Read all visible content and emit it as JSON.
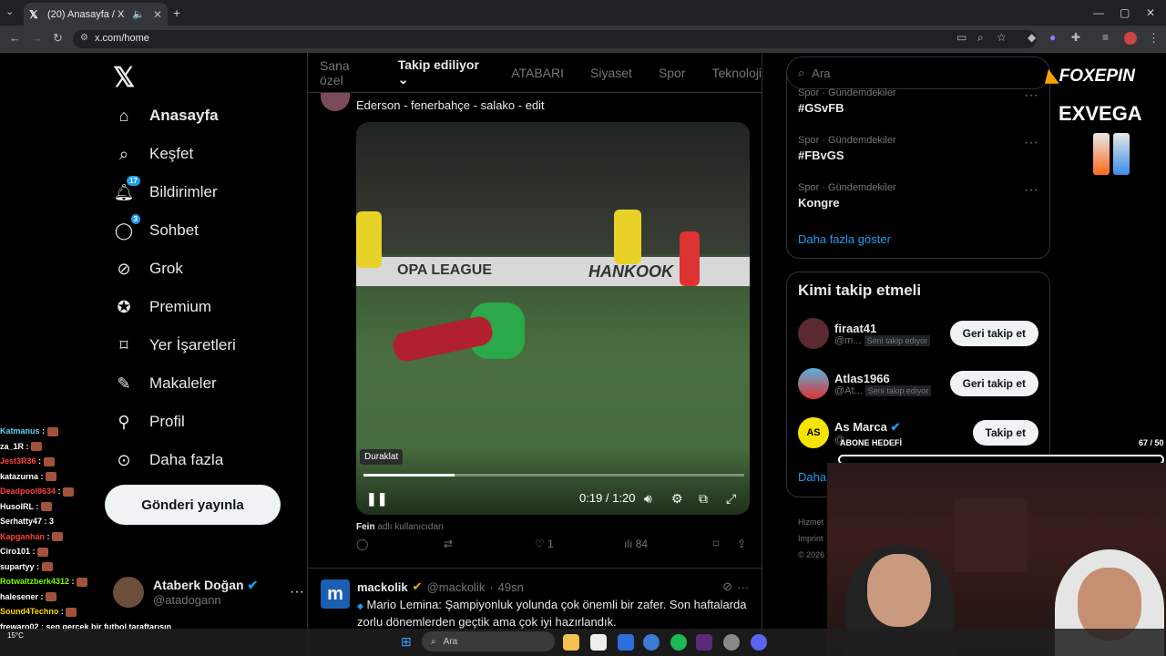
{
  "browser": {
    "tab_title": "(20) Anasayfa / X",
    "url": "x.com/home"
  },
  "sidebar": {
    "items": [
      {
        "label": "Anasayfa",
        "icon": "home-icon"
      },
      {
        "label": "Keşfet",
        "icon": "search-icon"
      },
      {
        "label": "Bildirimler",
        "icon": "bell-icon",
        "badge": "17"
      },
      {
        "label": "Sohbet",
        "icon": "chat-icon",
        "badge": "3"
      },
      {
        "label": "Grok",
        "icon": "grok-icon"
      },
      {
        "label": "Premium",
        "icon": "premium-icon"
      },
      {
        "label": "Yer İşaretleri",
        "icon": "bookmark-icon"
      },
      {
        "label": "Makaleler",
        "icon": "article-icon"
      },
      {
        "label": "Profil",
        "icon": "profile-icon"
      },
      {
        "label": "Daha fazla",
        "icon": "more-circle-icon"
      }
    ],
    "post_button": "Gönderi yayınla",
    "user": {
      "name": "Ataberk Doğan",
      "handle": "@atadogann"
    }
  },
  "feed": {
    "tabs": [
      "Sana özel",
      "Takip ediliyor",
      "ATABARI",
      "Siyaset",
      "Spor",
      "Teknoloji"
    ],
    "active_tab": "Takip ediliyor",
    "tweet1": {
      "text": "Ederson - fenerbahçe - salako - edit",
      "video": {
        "tooltip": "Duraklat",
        "time": "0:19 / 1:20",
        "progress": 0.24,
        "ad_text": "OPA LEAGUE",
        "ad_brand": "HANKOOK"
      },
      "source_user": "Fein",
      "source_suffix": "adlı kullanıcıdan",
      "likes": "1",
      "views": "84"
    },
    "tweet2": {
      "name": "mackolik",
      "handle": "@mackolik",
      "time": "49sn",
      "avatar_letter": "m",
      "text": "Mario Lemina: Şampiyonluk yolunda çok önemli bir zafer. Son haftalarda zorlu dönemlerden geçtik ama çok iyi hazırlandık."
    }
  },
  "right": {
    "search_placeholder": "Ara",
    "trends": [
      {
        "meta": "Spor · Gündemdekiler",
        "name": "#GSvFB"
      },
      {
        "meta": "Spor · Gündemdekiler",
        "name": "#FBvGS"
      },
      {
        "meta": "Spor · Gündemdekiler",
        "name": "Kongre"
      }
    ],
    "show_more": "Daha fazla göster",
    "who_to_follow": {
      "title": "Kimi takip etmeli",
      "users": [
        {
          "name": "firaat41",
          "handle": "@m...",
          "tag": "Seni takip ediyor",
          "button": "Geri takip et"
        },
        {
          "name": "Atlas1966",
          "handle": "@At...",
          "tag": "Seni takip ediyor",
          "button": "Geri takip et"
        },
        {
          "name": "As Marca",
          "handle": "@",
          "tag": "",
          "button": "Takip et"
        }
      ],
      "more": "Daha"
    },
    "footer": [
      "Hizmet",
      "Imprint",
      "© 2026"
    ]
  },
  "overlay": {
    "foxepin": "FOXEPIN",
    "exvega": "EXVEGA",
    "sub_goal_label": "ABONE HEDEFİ",
    "sub_goal_count": "67 / 50",
    "sub_goal_progress": 1.0,
    "chat": [
      {
        "user": "Katmanus",
        "msg": "",
        "color": "#5fd3f3"
      },
      {
        "user": "za_1R",
        "msg": "",
        "color": "#ffffff"
      },
      {
        "user": "Jest3R36",
        "msg": "",
        "color": "#ff4040"
      },
      {
        "user": "katazurna",
        "msg": "",
        "color": "#ffffff"
      },
      {
        "user": "Deadpool0634",
        "msg": "",
        "color": "#ff4040"
      },
      {
        "user": "HusoIRL",
        "msg": "",
        "color": "#ffffff"
      },
      {
        "user": "Serhatty47",
        "msg": "3",
        "color": "#ffffff"
      },
      {
        "user": "Kapganhan",
        "msg": "",
        "color": "#ff4040"
      },
      {
        "user": "Ciro101",
        "msg": "",
        "color": "#ffffff"
      },
      {
        "user": "supartyy",
        "msg": "",
        "color": "#ffffff"
      },
      {
        "user": "Rotwaltzberk4312",
        "msg": "",
        "color": "#7cfc00"
      },
      {
        "user": "halesener",
        "msg": "",
        "color": "#ffffff"
      },
      {
        "user": "Sound4Techno",
        "msg": "",
        "color": "#ffd700"
      },
      {
        "user": "frewaro02",
        "msg": "sen gerçek bir futbol taraftarısın",
        "color": "#ffffff"
      }
    ],
    "weather": "15°C"
  },
  "taskbar": {
    "search": "Ara"
  }
}
